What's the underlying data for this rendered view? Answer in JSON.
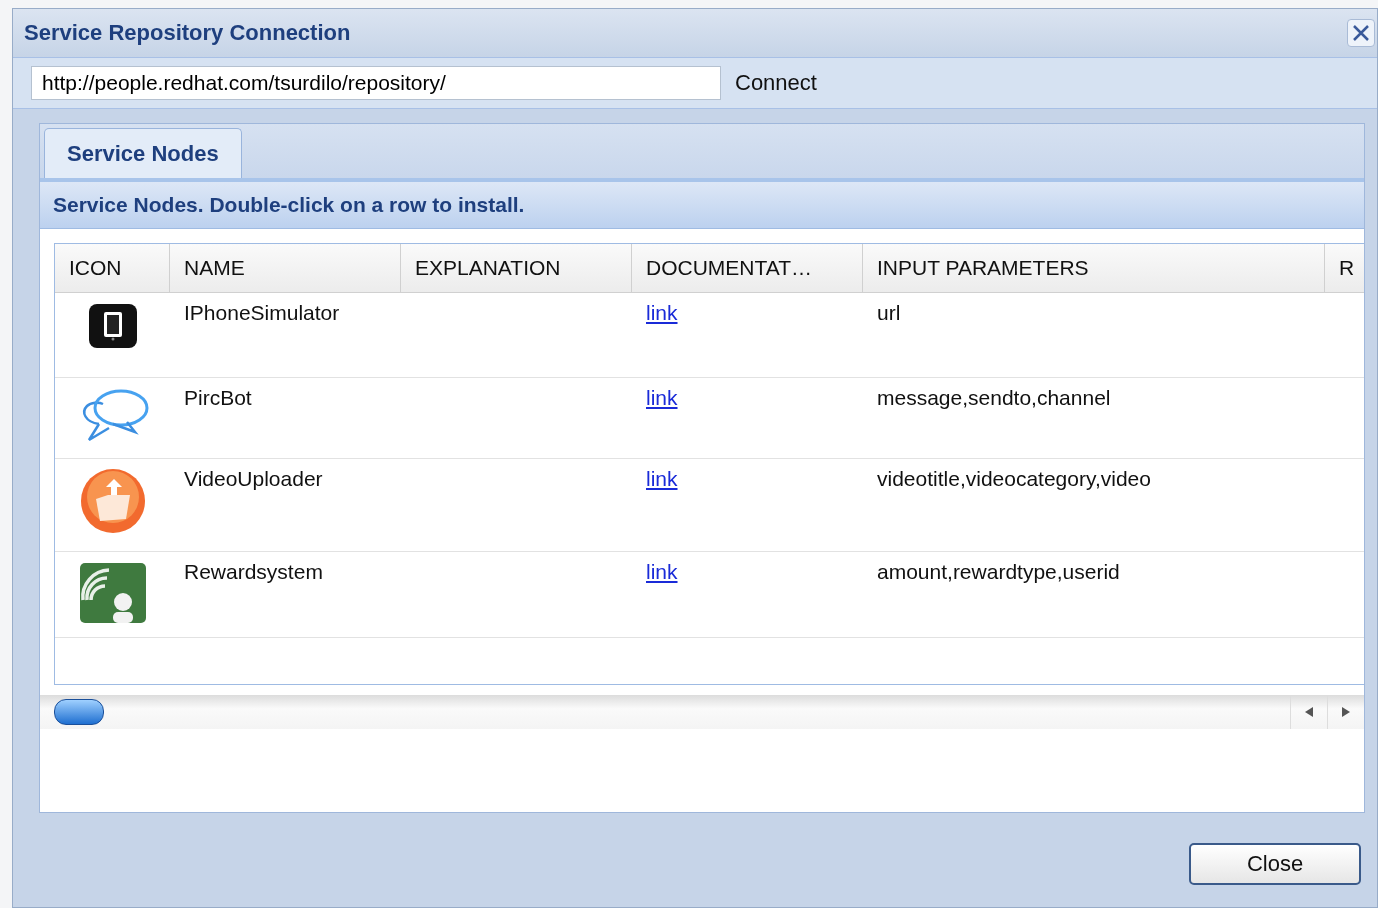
{
  "window": {
    "title": "Service Repository Connection"
  },
  "url_field": {
    "value": "http://people.redhat.com/tsurdilo/repository/"
  },
  "connect_button": "Connect",
  "tabs": [
    {
      "label": "Service Nodes",
      "selected": true
    }
  ],
  "panel_heading": "Service Nodes. Double-click on a row to install.",
  "table": {
    "columns": [
      "ICON",
      "NAME",
      "EXPLANATION",
      "DOCUMENTAT…",
      "INPUT PARAMETERS",
      "R"
    ],
    "rows": [
      {
        "name": "IPhoneSimulator",
        "documentation": "link",
        "input_parameters": "url"
      },
      {
        "name": "PircBot",
        "documentation": "link",
        "input_parameters": "message,sendto,channel"
      },
      {
        "name": "VideoUploader",
        "documentation": "link",
        "input_parameters": "videotitle,videocategory,video"
      },
      {
        "name": "Rewardsystem",
        "documentation": "link",
        "input_parameters": "amount,rewardtype,userid"
      }
    ]
  },
  "close_button": "Close"
}
